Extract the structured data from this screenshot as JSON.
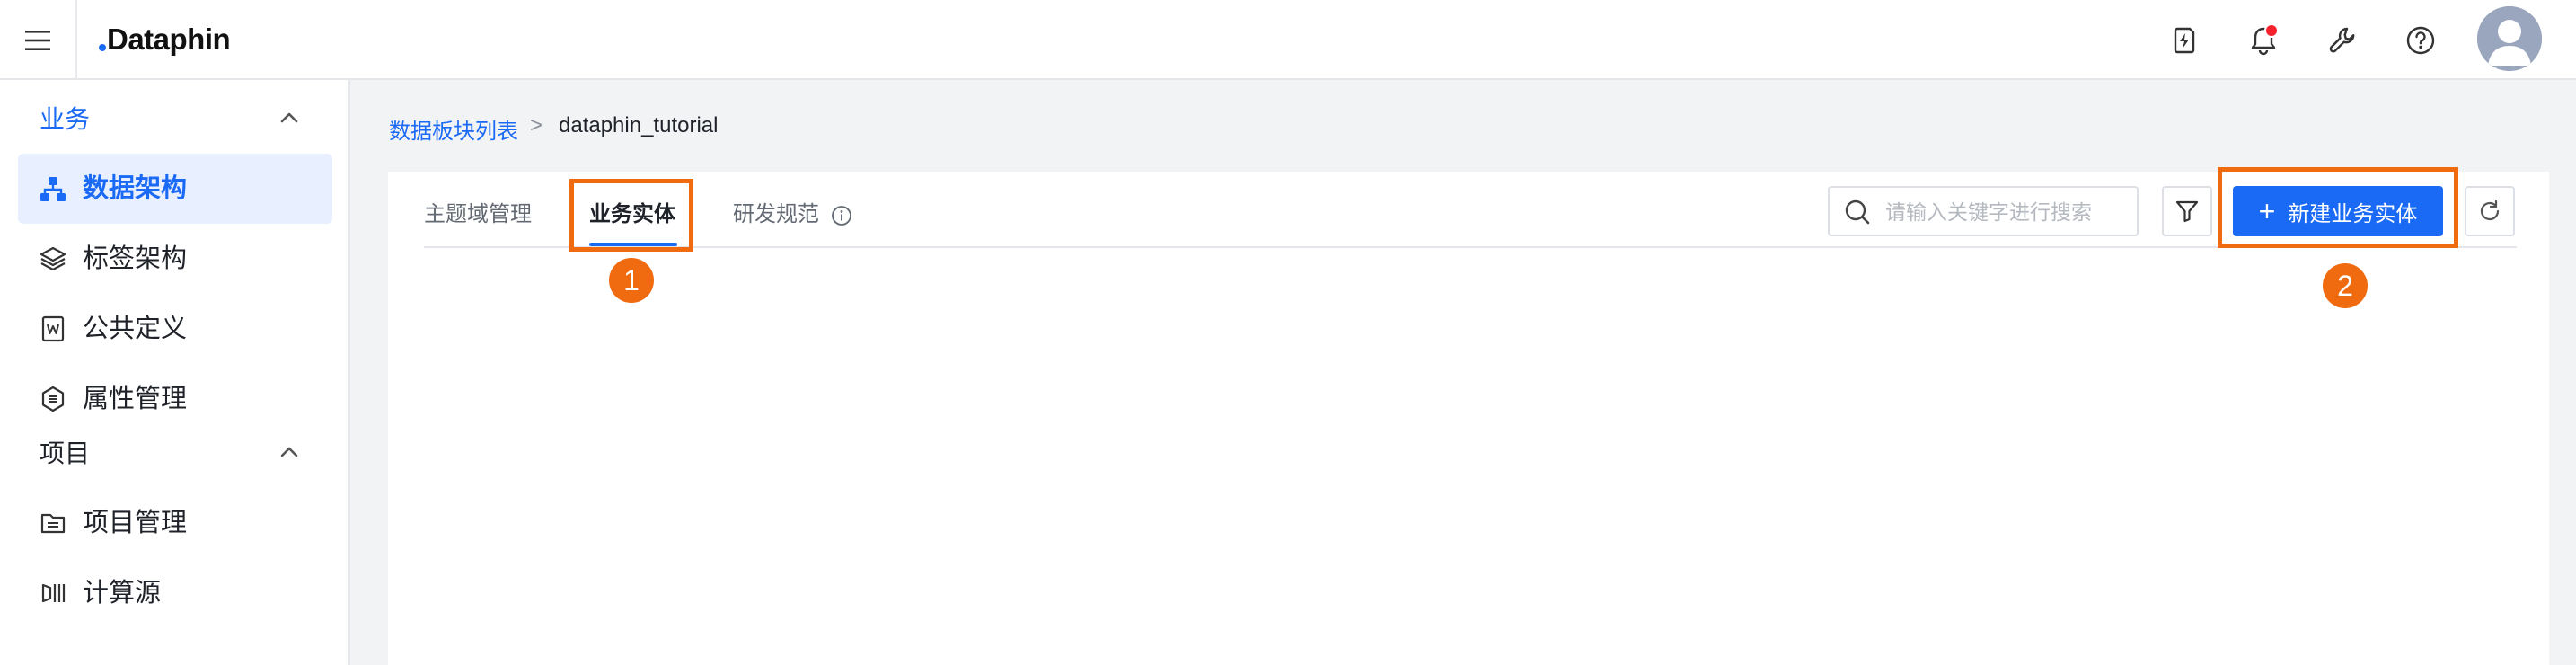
{
  "header": {
    "brand": "Dataphin",
    "icons": [
      "menu-icon",
      "flash-icon",
      "bell-icon",
      "wrench-icon",
      "help-icon"
    ],
    "notification_dot_color": "#f5222d"
  },
  "sidebar": {
    "groups": [
      {
        "label": "业务",
        "expanded": true,
        "items": [
          {
            "label": "数据架构",
            "icon": "org-tree-icon",
            "active": true
          },
          {
            "label": "标签架构",
            "icon": "layers-icon",
            "active": false
          },
          {
            "label": "公共定义",
            "icon": "doc-w-icon",
            "active": false
          },
          {
            "label": "属性管理",
            "icon": "property-icon",
            "active": false
          }
        ]
      },
      {
        "label": "项目",
        "expanded": true,
        "items": [
          {
            "label": "项目管理",
            "icon": "folder-icon",
            "active": false
          },
          {
            "label": "计算源",
            "icon": "compute-source-icon",
            "active": false
          }
        ]
      }
    ]
  },
  "breadcrumb": {
    "parent": "数据板块列表",
    "separator": ">",
    "current": "dataphin_tutorial"
  },
  "tabs": [
    {
      "label": "主题域管理",
      "active": false
    },
    {
      "label": "业务实体",
      "active": true
    },
    {
      "label": "研发规范",
      "active": false,
      "has_info_icon": true
    }
  ],
  "toolbar": {
    "search_placeholder": "请输入关键字进行搜索",
    "search_value": "",
    "new_button_label": "新建业务实体",
    "new_button_icon": "+"
  },
  "annotations": {
    "step1": "1",
    "step2": "2",
    "color": "#f06a0f"
  },
  "colors": {
    "primary": "#1b6af5",
    "active_bg": "#e8f0ff",
    "page_bg": "#f2f3f5"
  }
}
